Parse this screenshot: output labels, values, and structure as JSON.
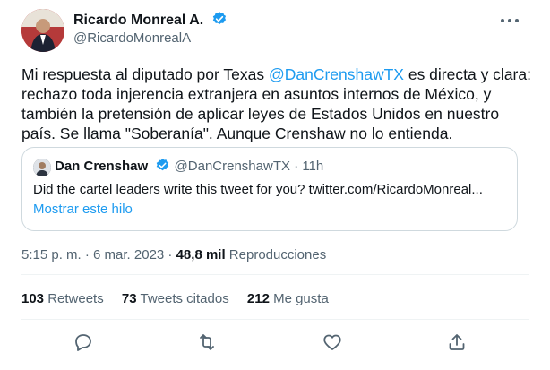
{
  "author": {
    "name": "Ricardo Monreal A.",
    "handle": "@RicardoMonrealA",
    "verified": true,
    "avatar_icon": "avatar-photo"
  },
  "tweet": {
    "text_before": "Mi respuesta al diputado por Texas ",
    "mention": "@DanCrenshawTX",
    "text_after": " es directa y clara: rechazo toda  injerencia extranjera en asuntos internos de México, y también la pretensión de aplicar leyes de Estados Unidos en nuestro país. Se llama \"Soberanía\". Aunque Crenshaw no lo entienda."
  },
  "quoted": {
    "name": "Dan Crenshaw",
    "handle": "@DanCrenshawTX · 11h",
    "text": "Did the cartel leaders write this tweet for you? twitter.com/RicardoMonreal...",
    "show_thread": "Mostrar este hilo"
  },
  "meta": {
    "time": "5:15 p. m. · 6 mar. 2023 · ",
    "views": "48,8 mil",
    "views_label": " Reproducciones"
  },
  "stats": {
    "retweets_count": "103",
    "retweets_label": " Retweets",
    "quotes_count": "73",
    "quotes_label": " Tweets citados",
    "likes_count": "212",
    "likes_label": " Me gusta"
  },
  "colors": {
    "accent": "#1d9bf0",
    "text": "#0f1419",
    "secondary": "#536471",
    "border": "#cfd9de"
  },
  "icons": [
    "more-icon",
    "verified-badge-icon",
    "reply-icon",
    "retweet-icon",
    "like-icon",
    "share-icon"
  ]
}
